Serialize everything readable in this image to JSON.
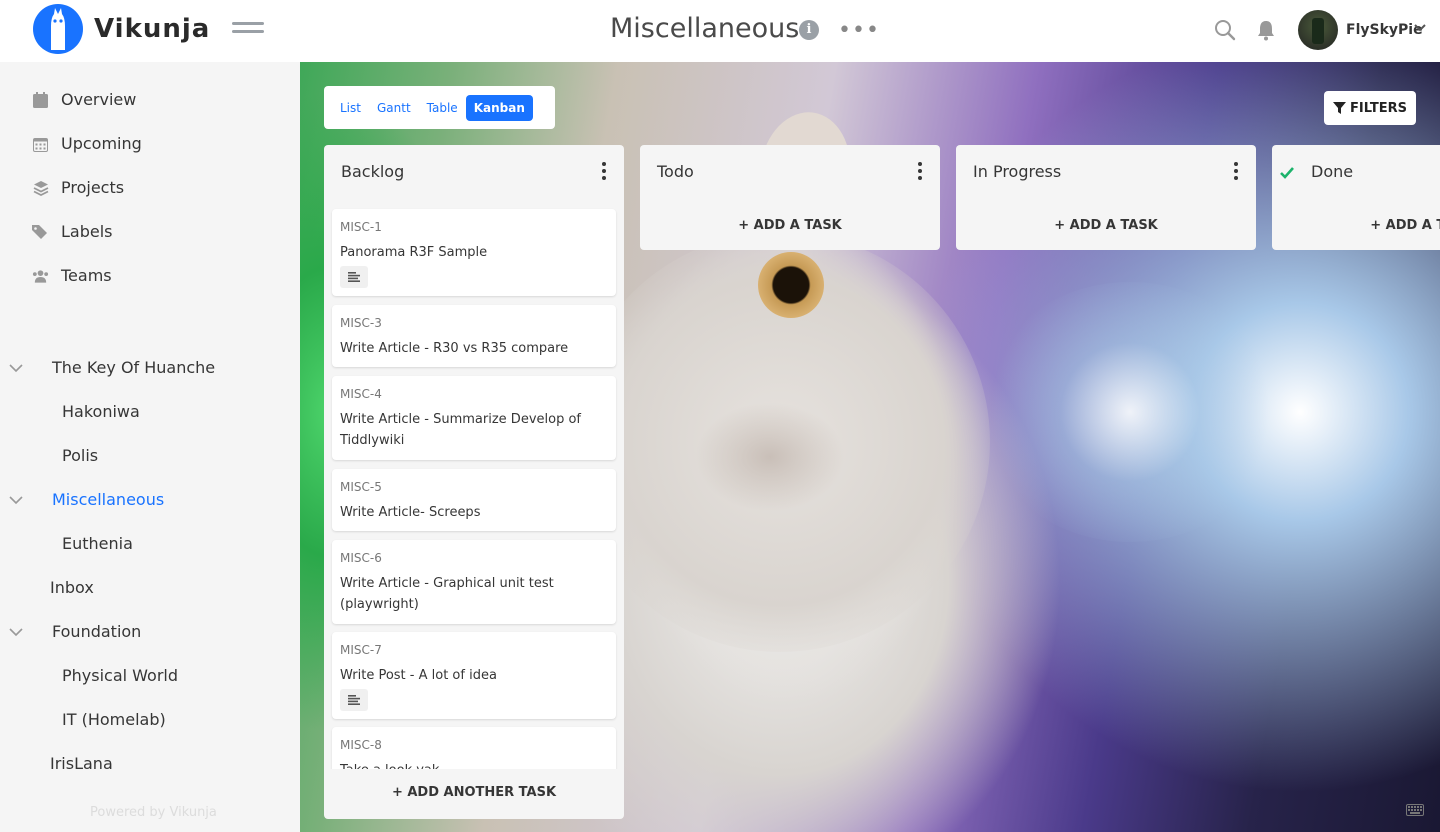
{
  "app": {
    "name": "Vikunja"
  },
  "header": {
    "project_title": "Miscellaneous",
    "username": "FlySkyPie"
  },
  "sidebar": {
    "nav": [
      {
        "label": "Overview",
        "icon": "calendar-icon"
      },
      {
        "label": "Upcoming",
        "icon": "calendar-grid-icon"
      },
      {
        "label": "Projects",
        "icon": "layers-icon"
      },
      {
        "label": "Labels",
        "icon": "tags-icon"
      },
      {
        "label": "Teams",
        "icon": "users-icon"
      }
    ],
    "projects": [
      {
        "label": "The Key Of Huanche"
      },
      {
        "label": "Hakoniwa"
      },
      {
        "label": "Polis"
      },
      {
        "label": "Miscellaneous"
      },
      {
        "label": "Euthenia"
      },
      {
        "label": "Inbox"
      },
      {
        "label": "Foundation"
      },
      {
        "label": "Physical World"
      },
      {
        "label": "IT (Homelab)"
      },
      {
        "label": "IrisLana"
      }
    ],
    "powered_by": "Powered by Vikunja"
  },
  "views": {
    "list": "List",
    "gantt": "Gantt",
    "table": "Table",
    "kanban": "Kanban"
  },
  "filters_label": "FILTERS",
  "buckets": [
    {
      "title": "Backlog",
      "add_label": "ADD ANOTHER TASK",
      "tasks": [
        {
          "id": "MISC-1",
          "title": "Panorama R3F Sample"
        },
        {
          "id": "MISC-3",
          "title": "Write Article - R30 vs R35 compare"
        },
        {
          "id": "MISC-4",
          "title": "Write Article - Summarize Develop of Tiddlywiki"
        },
        {
          "id": "MISC-5",
          "title": "Write Article- Screeps"
        },
        {
          "id": "MISC-6",
          "title": "Write Article - Graphical unit test (playwright)"
        },
        {
          "id": "MISC-7",
          "title": "Write Post - A lot of idea"
        },
        {
          "id": "MISC-8",
          "title": "Take a look yak"
        }
      ]
    },
    {
      "title": "Todo",
      "add_label": "ADD A TASK"
    },
    {
      "title": "In Progress",
      "add_label": "ADD A TASK"
    },
    {
      "title": "Done",
      "add_label": "ADD A TASK"
    }
  ]
}
